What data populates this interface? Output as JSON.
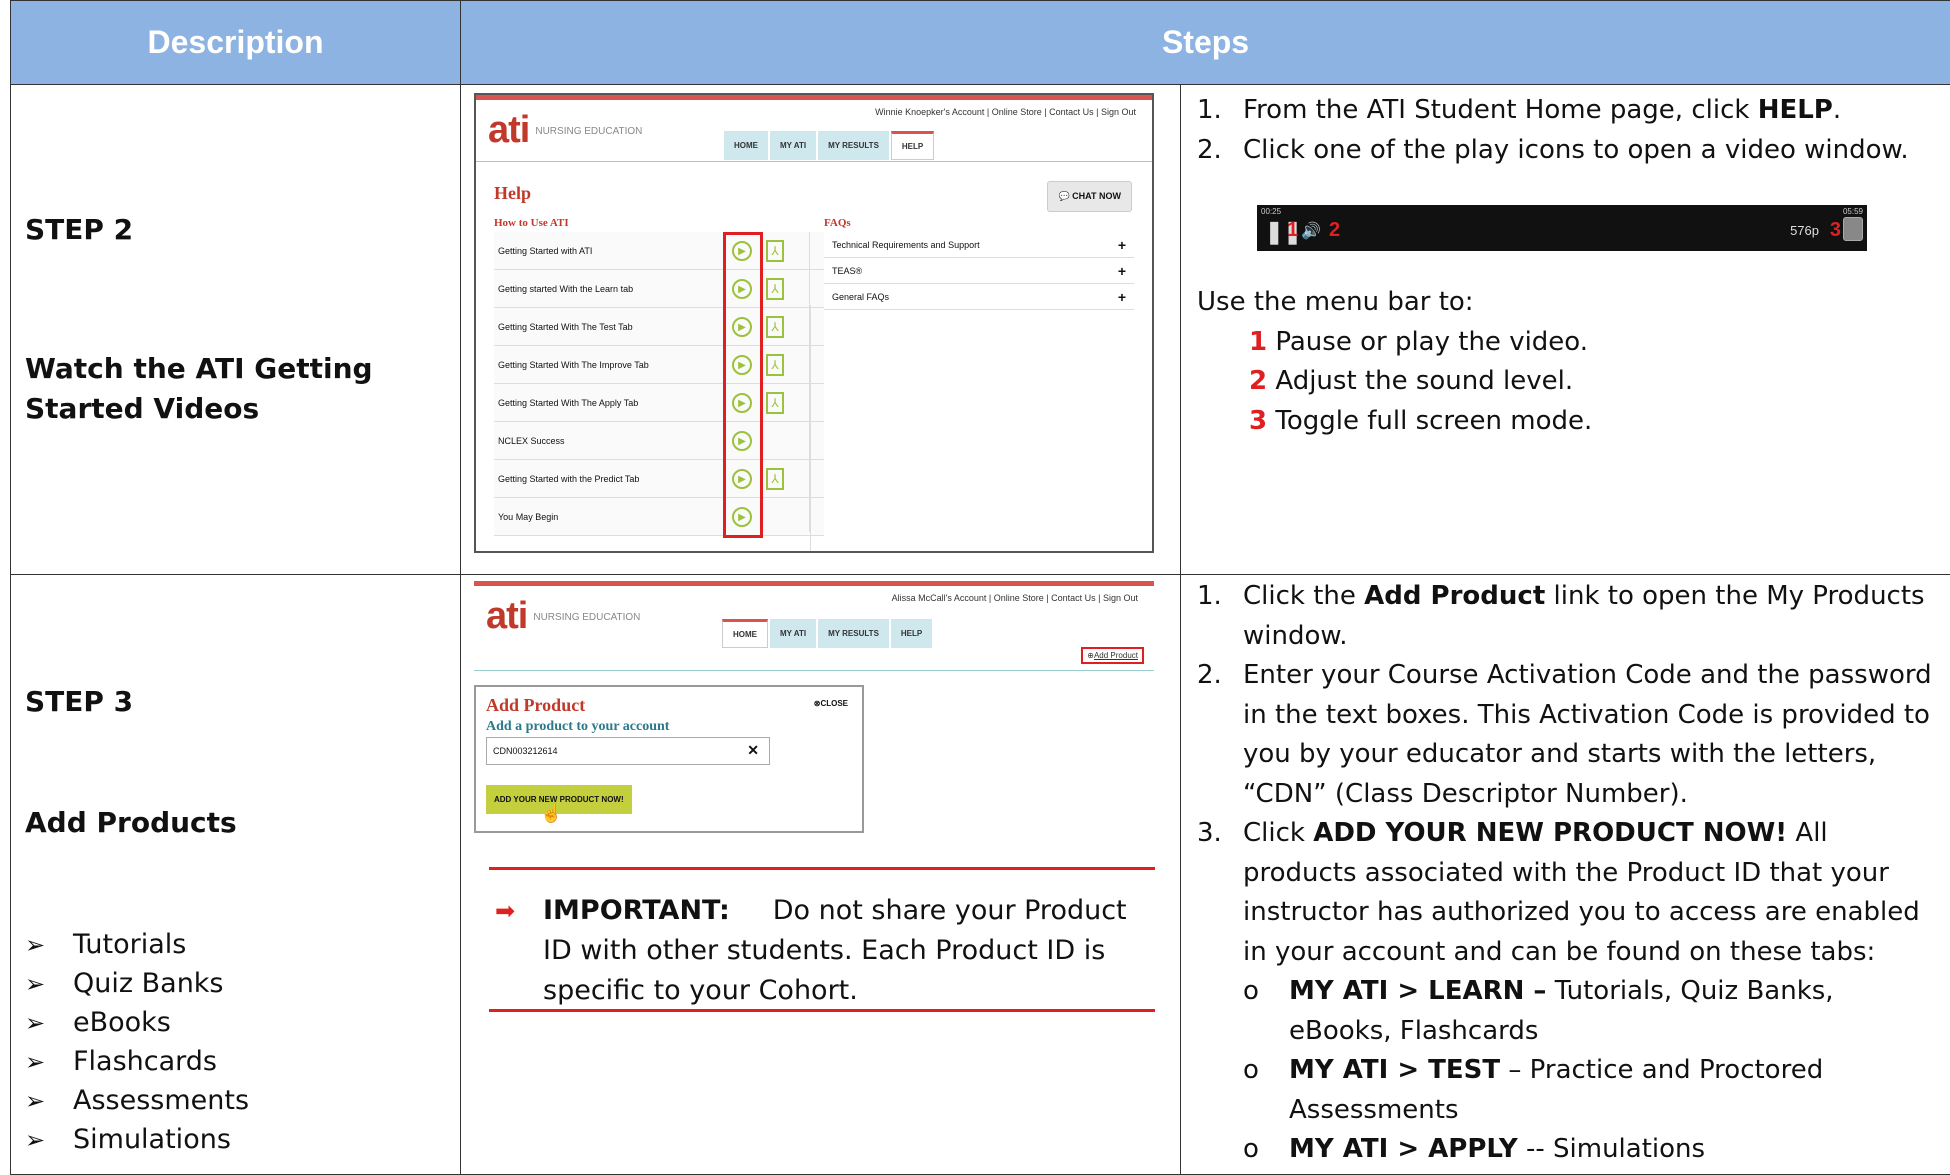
{
  "header": {
    "col1": "Description",
    "col2": "Steps"
  },
  "step2": {
    "title": "STEP 2",
    "subtitle": "Watch the ATI Getting Started Videos",
    "screenshot": {
      "logo": "ati",
      "logo_sub": "NURSING EDUCATION",
      "account": "Winnie Knoepker's Account | Online Store | Contact Us | Sign Out",
      "tabs": [
        "HOME",
        "MY ATI",
        "MY RESULTS",
        "HELP"
      ],
      "heading": "Help",
      "chat": "CHAT NOW",
      "how_to": "How to Use ATI",
      "faqs": "FAQs",
      "videos": [
        "Getting Started with ATI",
        "Getting started With the Learn tab",
        "Getting Started With The Test Tab",
        "Getting Started With The Improve Tab",
        "Getting Started With The Apply Tab",
        "NCLEX Success",
        "Getting Started with the Predict Tab",
        "You May Begin"
      ],
      "faq_items": [
        "Technical Requirements and Support",
        "TEAS®",
        "General FAQs"
      ]
    },
    "steps": [
      {
        "num": "1.",
        "pre": "From the ATI Student Home page, click ",
        "bold": "HELP",
        "post": "."
      },
      {
        "num": "2.",
        "pre": "Click one of the play icons to open a video window.",
        "bold": "",
        "post": ""
      }
    ],
    "player": {
      "time_left": "00:25",
      "time_right": "05:59",
      "quality": "576p",
      "m1": "1",
      "m2": "2",
      "m3": "3"
    },
    "menu_intro": "Use the menu bar to:",
    "menu_items": [
      {
        "n": "1",
        "text": "Pause or play the video."
      },
      {
        "n": "2",
        "text": "Adjust the sound level."
      },
      {
        "n": "3",
        "text": "Toggle full screen mode."
      }
    ]
  },
  "step3": {
    "title": "STEP 3",
    "subtitle": "Add Products",
    "bullets": [
      "Tutorials",
      "Quiz Banks",
      "eBooks",
      "Flashcards",
      "Assessments",
      "Simulations"
    ],
    "screenshot": {
      "account": "Alissa McCall's Account | Online Store | Contact Us | Sign Out",
      "tabs": [
        "HOME",
        "MY ATI",
        "MY RESULTS",
        "HELP"
      ],
      "add_link": "Add Product",
      "dialog_title": "Add Product",
      "close": "CLOSE",
      "dialog_sub": "Add a product to your account",
      "code": "CDN003212614",
      "button": "ADD YOUR NEW PRODUCT NOW!"
    },
    "important_label": "IMPORTANT:",
    "important_text": "Do not share your Product ID with other students. Each Product ID is specific to your Cohort.",
    "steps": {
      "s1_pre": "Click the ",
      "s1_bold": "Add Product",
      "s1_post": " link to open the My Products window.",
      "s2": "Enter your Course Activation Code and the password in the text boxes. This Activation Code is provided to you by your educator and starts with the letters, “CDN” (Class Descriptor Number).",
      "s3_pre": "Click ",
      "s3_bold": "ADD YOUR NEW PRODUCT NOW!",
      "s3_post": " All products associated with the Product ID that your instructor has authorized you to access are enabled in your account and can be found on these tabs:",
      "o1_bold": "MY ATI > LEARN –",
      "o1_text": " Tutorials, Quiz Banks, eBooks, Flashcards",
      "o2_bold": "MY ATI > TEST",
      "o2_text": " – Practice and Proctored Assessments",
      "o3_bold": "MY ATI > APPLY",
      "o3_text": " -- Simulations"
    }
  }
}
